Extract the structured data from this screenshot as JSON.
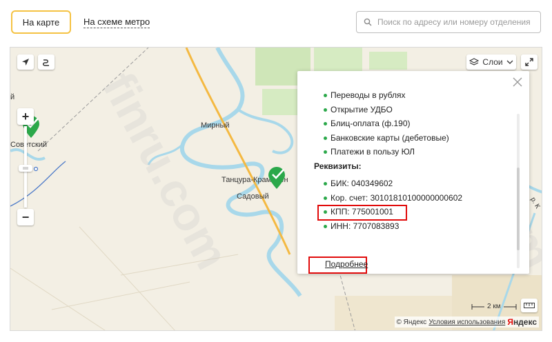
{
  "tabs": {
    "map_label": "На карте",
    "metro_label": "На схеме метро"
  },
  "search": {
    "placeholder": "Поиск по адресу или номеру отделения",
    "icon": "search-icon"
  },
  "map": {
    "layers_label": "Слои",
    "zoom_in": "+",
    "zoom_out": "−",
    "scale_label": "2 км",
    "places": {
      "mirny": "Мирный",
      "tantsura": "Танцура-Крамаренко",
      "sadovy": "Садовый",
      "sovetsky": "Советский",
      "y_edge": "й",
      "road": "р. К"
    },
    "watermark": "finru.com",
    "copyright": "© Яндекс",
    "terms": "Условия использования",
    "logo_first": "Я",
    "logo_rest": "ндекс"
  },
  "popup": {
    "features": [
      "Переводы в рублях",
      "Открытие УДБО",
      "Блиц-оплата (ф.190)",
      "Банковские карты (дебетовые)",
      "Платежи в пользу ЮЛ"
    ],
    "requisites_title": "Реквизиты:",
    "requisites": [
      "БИК: 040349602",
      "Кор. счет: 30101810100000000602",
      "КПП: 775001001",
      "ИНН: 7707083893"
    ],
    "more_link": "Подробнее"
  },
  "colors": {
    "accent": "#f5c242",
    "highlight": "#e10a0a",
    "bullet": "#2ba84a",
    "water": "#a8d8ea",
    "road": "#f4b942"
  }
}
